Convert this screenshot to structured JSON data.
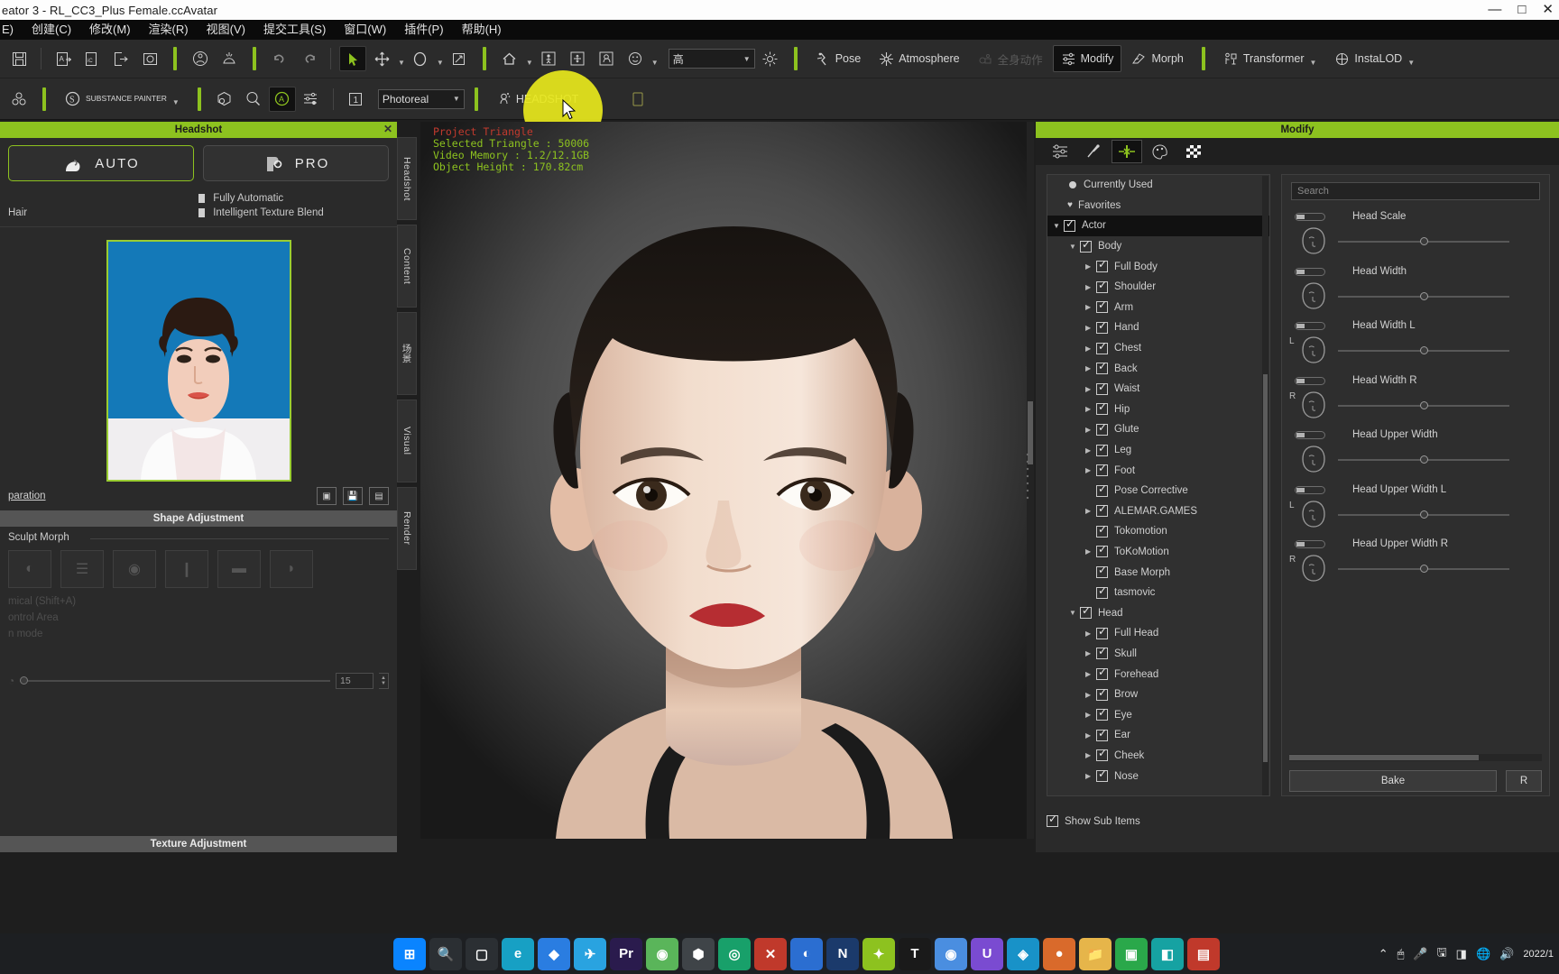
{
  "window": {
    "title": "eator 3 - RL_CC3_Plus Female.ccAvatar",
    "minimize": "—",
    "maximize": "□",
    "close": "✕"
  },
  "menubar": {
    "items": [
      {
        "label": "E)"
      },
      {
        "label": "创建(C)"
      },
      {
        "label": "修改(M)"
      },
      {
        "label": "渲染(R)"
      },
      {
        "label": "视图(V)"
      },
      {
        "label": "提交工具(S)"
      },
      {
        "label": "窗口(W)"
      },
      {
        "label": "插件(P)"
      },
      {
        "label": "帮助(H)"
      }
    ]
  },
  "toolbar_top": {
    "buttons": [
      {
        "name": "save",
        "icon": "save-icon"
      },
      {
        "name": "import-avatar",
        "icon": "import-avatar-icon"
      },
      {
        "name": "import-object",
        "icon": "import-object-icon"
      },
      {
        "name": "export",
        "icon": "export-icon"
      },
      {
        "name": "preview",
        "icon": "preview-icon"
      },
      {
        "name": "apply-pose",
        "icon": "cube-person-icon"
      },
      {
        "name": "hairline",
        "icon": "hair-icon"
      },
      {
        "name": "undo",
        "icon": "undo-icon"
      },
      {
        "name": "redo",
        "icon": "redo-icon"
      },
      {
        "name": "select-tool",
        "icon": "arrow-cursor-icon"
      },
      {
        "name": "move-tool",
        "icon": "move-icon"
      },
      {
        "name": "rotate-tool",
        "icon": "rotate-icon"
      },
      {
        "name": "scale-tool",
        "icon": "scale-icon"
      },
      {
        "name": "home-view",
        "icon": "home-icon"
      },
      {
        "name": "fit-person",
        "icon": "person-fit-icon"
      },
      {
        "name": "frame-all",
        "icon": "frame-icon"
      },
      {
        "name": "face-view",
        "icon": "face-view-icon"
      },
      {
        "name": "expression",
        "icon": "smiley-icon"
      },
      {
        "name": "light",
        "icon": "sun-icon"
      }
    ],
    "quality_dropdown": {
      "value": "高"
    },
    "pose_label": "Pose",
    "atmosphere_label": "Atmosphere",
    "disabled_label": "全身动作",
    "modify_label": "Modify",
    "morph_label": "Morph",
    "transformer_label": "Transformer",
    "instalod_label": "InstaLOD"
  },
  "toolbar_second": {
    "substance_label": "SUBSTANCE PAINTER",
    "render_dropdown": {
      "value": "Photoreal"
    },
    "headshot_label": "HEADSHOT",
    "buttons": [
      {
        "name": "accessory",
        "icon": "accessory-icon"
      },
      {
        "name": "material",
        "icon": "material-icon"
      },
      {
        "name": "inspect",
        "icon": "magnifier-icon"
      },
      {
        "name": "auto-setup",
        "icon": "a-circle-icon"
      },
      {
        "name": "settings-mixer",
        "icon": "mixer-icon"
      },
      {
        "name": "frame-number",
        "icon": "frame-number-icon"
      }
    ]
  },
  "headshot_panel": {
    "title": "Headshot",
    "close": "✕",
    "modes": [
      {
        "label": "AUTO",
        "icon": "head-auto-icon",
        "selected": true
      },
      {
        "label": "PRO",
        "icon": "head-pro-icon",
        "selected": false
      }
    ],
    "options_left": [
      {
        "label": ""
      },
      {
        "label": "Hair"
      }
    ],
    "options_right": [
      {
        "label": "Fully Automatic"
      },
      {
        "label": "Intelligent Texture Blend"
      }
    ],
    "preparation_link": "paration",
    "mini_buttons": [
      {
        "name": "load-image",
        "icon": "load-image-icon"
      },
      {
        "name": "save-image",
        "icon": "save-image-icon"
      },
      {
        "name": "reset-image",
        "icon": "reset-image-icon"
      }
    ],
    "shape_adjustment_title": "Shape Adjustment",
    "sculpt_morph_label": "Sculpt Morph",
    "sculpt_buttons": [
      {
        "name": "sculpt-1"
      },
      {
        "name": "sculpt-2"
      },
      {
        "name": "sculpt-3"
      },
      {
        "name": "sculpt-4"
      },
      {
        "name": "sculpt-5"
      },
      {
        "name": "sculpt-6"
      }
    ],
    "dim_lines": [
      "mical (Shift+A)",
      "ontrol Area",
      "n mode"
    ],
    "strength_value": "15",
    "texture_adjustment_title": "Texture Adjustment"
  },
  "vtabs": [
    {
      "label": "Headshot"
    },
    {
      "label": "Content"
    },
    {
      "label": "场景"
    },
    {
      "label": "Visual"
    },
    {
      "label": "Render"
    }
  ],
  "viewport": {
    "stats": [
      {
        "text": "Project Triangle",
        "color": "#c13a2e"
      },
      {
        "text": "Selected Triangle : 50006",
        "color": "#8dc21f"
      },
      {
        "text": "Video Memory : 1.2/12.1GB",
        "color": "#8dc21f"
      },
      {
        "text": "Object Height : 170.82cm",
        "color": "#8dc21f"
      }
    ]
  },
  "modify_panel": {
    "title": "Modify",
    "tabs": [
      {
        "name": "attribute",
        "icon": "sliders-icon",
        "active": false
      },
      {
        "name": "pose-edit",
        "icon": "pose-edit-icon",
        "active": false
      },
      {
        "name": "morph-edit",
        "icon": "morph-arrows-icon",
        "active": true
      },
      {
        "name": "material",
        "icon": "palette-icon",
        "active": false
      },
      {
        "name": "texture",
        "icon": "checker-icon",
        "active": false
      }
    ],
    "search_placeholder": "Search",
    "tree": [
      {
        "label": "Currently Used",
        "indent": 0,
        "type": "bullet"
      },
      {
        "label": "Favorites",
        "indent": 0,
        "type": "heart"
      },
      {
        "label": "Actor",
        "indent": 0,
        "type": "check",
        "expanded": true,
        "selected": true
      },
      {
        "label": "Body",
        "indent": 1,
        "type": "check",
        "expanded": true
      },
      {
        "label": "Full Body",
        "indent": 2,
        "type": "check",
        "collapsed": true
      },
      {
        "label": "Shoulder",
        "indent": 2,
        "type": "check",
        "collapsed": true
      },
      {
        "label": "Arm",
        "indent": 2,
        "type": "check",
        "collapsed": true
      },
      {
        "label": "Hand",
        "indent": 2,
        "type": "check",
        "collapsed": true
      },
      {
        "label": "Chest",
        "indent": 2,
        "type": "check",
        "collapsed": true
      },
      {
        "label": "Back",
        "indent": 2,
        "type": "check",
        "collapsed": true
      },
      {
        "label": "Waist",
        "indent": 2,
        "type": "check",
        "collapsed": true
      },
      {
        "label": "Hip",
        "indent": 2,
        "type": "check",
        "collapsed": true
      },
      {
        "label": "Glute",
        "indent": 2,
        "type": "check",
        "collapsed": true
      },
      {
        "label": "Leg",
        "indent": 2,
        "type": "check",
        "collapsed": true
      },
      {
        "label": "Foot",
        "indent": 2,
        "type": "check",
        "collapsed": true
      },
      {
        "label": "Pose Corrective",
        "indent": 2,
        "type": "check"
      },
      {
        "label": "ALEMAR.GAMES",
        "indent": 2,
        "type": "check",
        "collapsed": true
      },
      {
        "label": "Tokomotion",
        "indent": 2,
        "type": "check"
      },
      {
        "label": "ToKoMotion",
        "indent": 2,
        "type": "check",
        "collapsed": true
      },
      {
        "label": "Base Morph",
        "indent": 2,
        "type": "check"
      },
      {
        "label": "tasmovic",
        "indent": 2,
        "type": "check"
      },
      {
        "label": "Head",
        "indent": 1,
        "type": "check",
        "expanded": true
      },
      {
        "label": "Full Head",
        "indent": 2,
        "type": "check",
        "collapsed": true
      },
      {
        "label": "Skull",
        "indent": 2,
        "type": "check",
        "collapsed": true
      },
      {
        "label": "Forehead",
        "indent": 2,
        "type": "check",
        "collapsed": true
      },
      {
        "label": "Brow",
        "indent": 2,
        "type": "check",
        "collapsed": true
      },
      {
        "label": "Eye",
        "indent": 2,
        "type": "check",
        "collapsed": true
      },
      {
        "label": "Ear",
        "indent": 2,
        "type": "check",
        "collapsed": true
      },
      {
        "label": "Cheek",
        "indent": 2,
        "type": "check",
        "collapsed": true
      },
      {
        "label": "Nose",
        "indent": 2,
        "type": "check",
        "collapsed": true
      }
    ],
    "show_sub_items": "Show Sub Items",
    "morph_sliders": [
      {
        "label": "Head Scale",
        "side": "",
        "knob_pct": 50
      },
      {
        "label": "Head Width",
        "side": "",
        "knob_pct": 50
      },
      {
        "label": "Head Width L",
        "side": "L",
        "knob_pct": 50
      },
      {
        "label": "Head Width R",
        "side": "R",
        "knob_pct": 50
      },
      {
        "label": "Head Upper Width",
        "side": "",
        "knob_pct": 50
      },
      {
        "label": "Head Upper Width L",
        "side": "L",
        "knob_pct": 50
      },
      {
        "label": "Head Upper Width R",
        "side": "R",
        "knob_pct": 50
      }
    ],
    "bake_label": "Bake",
    "reset_label": "R"
  },
  "taskbar": {
    "items": [
      {
        "name": "start",
        "glyph": "⊞",
        "color": "#0a84ff"
      },
      {
        "name": "search",
        "glyph": "🔍",
        "color": "#2b2f33"
      },
      {
        "name": "task-view",
        "glyph": "▢",
        "color": "#2b2f33"
      },
      {
        "name": "edge",
        "glyph": "e",
        "color": "#17a0c4"
      },
      {
        "name": "app-blue",
        "glyph": "◆",
        "color": "#2a7de1"
      },
      {
        "name": "app-teal",
        "glyph": "✈",
        "color": "#29a3e0"
      },
      {
        "name": "premiere",
        "glyph": "Pr",
        "color": "#2a1b4d"
      },
      {
        "name": "chrome-alt",
        "glyph": "◉",
        "color": "#5ab55a"
      },
      {
        "name": "unity",
        "glyph": "⬢",
        "color": "#3f4448"
      },
      {
        "name": "app-green",
        "glyph": "◎",
        "color": "#18a06a"
      },
      {
        "name": "app-red",
        "glyph": "✕",
        "color": "#c0392b"
      },
      {
        "name": "app-blue2",
        "glyph": "◐",
        "color": "#2b6ed1"
      },
      {
        "name": "app-navy",
        "glyph": "N",
        "color": "#1b3a6b"
      },
      {
        "name": "app-lime",
        "glyph": "✦",
        "color": "#8dc21f"
      },
      {
        "name": "app-black",
        "glyph": "T",
        "color": "#1a1a1a"
      },
      {
        "name": "chrome",
        "glyph": "◉",
        "color": "#4a8ee0"
      },
      {
        "name": "app-violet",
        "glyph": "U",
        "color": "#7a4bd1"
      },
      {
        "name": "app-cyan",
        "glyph": "◈",
        "color": "#1892c8"
      },
      {
        "name": "app-orange",
        "glyph": "●",
        "color": "#d96a2b"
      },
      {
        "name": "folder",
        "glyph": "📁",
        "color": "#e6b54a"
      },
      {
        "name": "app-green2",
        "glyph": "▣",
        "color": "#2aa84a"
      },
      {
        "name": "app-teal2",
        "glyph": "◧",
        "color": "#16a2a2"
      },
      {
        "name": "app-red2",
        "glyph": "▤",
        "color": "#c0392b"
      }
    ],
    "tray": {
      "chevron": "⌃",
      "icons": [
        "🖱",
        "🎤",
        "🖫",
        "◨"
      ],
      "network": "🌐",
      "volume": "🔊",
      "date": "2022/1"
    }
  }
}
